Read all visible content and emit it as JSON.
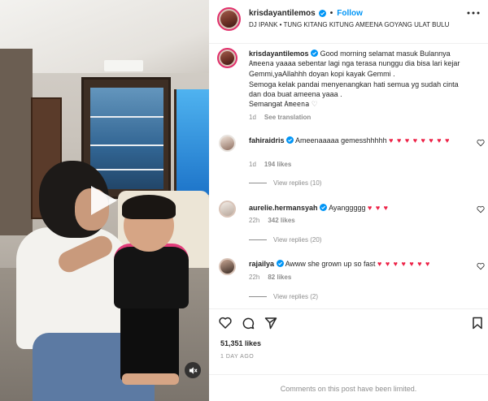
{
  "post": {
    "username": "krisdayantilemos",
    "follow_label": "Follow",
    "audio": "DJ IPANK • TUNG KITANG KITUNG AMEENA GOYANG ULAT BULU",
    "caption_user": "krisdayantilemos",
    "caption_line1": "Good morning selamat masuk Bulannya",
    "caption_ameena1": "Ameena",
    "caption_line2": "yaaaa sebentar lagi nga terasa nunggu dia bisa lari kejar",
    "caption_line3": "Gemmi,yaAllahhh doyan kopi kayak Gemmi .",
    "caption_line4": "Semoga kelak pandai menyenangkan hati semua yg sudah cinta",
    "caption_line5": "dan doa buat ameena yaaa .",
    "caption_line6": "Semangat",
    "caption_ameena2": "Ameena",
    "caption_emoji": "♡",
    "caption_time": "1d",
    "see_translation": "See translation",
    "likes": "51,351 likes",
    "date": "1 DAY AGO",
    "comments_limited": "Comments on this post have been limited."
  },
  "comments": [
    {
      "user": "fahiraidris",
      "text": "Ameenaaaaa gemesshhhhh",
      "hearts": "♥ ♥ ♥ ♥ ♥ ♥ ♥ ♥",
      "time": "1d",
      "likes": "194 likes",
      "replies": "View replies (10)"
    },
    {
      "user": "aurelie.hermansyah",
      "text": "Ayanggggg",
      "hearts": "♥ ♥ ♥",
      "time": "22h",
      "likes": "342 likes",
      "replies": "View replies (20)"
    },
    {
      "user": "rajailya",
      "text": "Awww she grown up so fast",
      "hearts": "♥ ♥ ♥ ♥ ♥ ♥ ♥",
      "time": "22h",
      "likes": "82 likes",
      "replies": "View replies (2)"
    }
  ],
  "icons": {
    "play": "play-icon",
    "mute": "volume-off-icon",
    "more": "more-options-icon",
    "like": "heart-icon",
    "comment": "comment-icon",
    "share": "share-icon",
    "save": "bookmark-icon",
    "verified": "verified-badge-icon"
  },
  "colors": {
    "accent": "#0095f6",
    "heart": "#ed2146",
    "muted": "#8e8e8e",
    "text": "#262626"
  }
}
